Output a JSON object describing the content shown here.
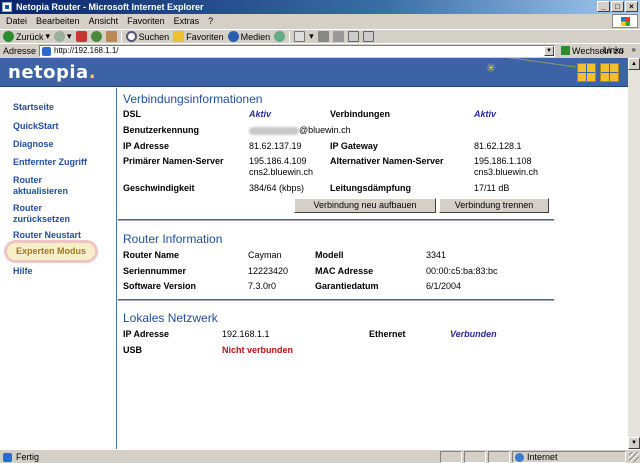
{
  "window": {
    "title": "Netopia Router - Microsoft Internet Explorer",
    "buttons": [
      "_",
      "□",
      "×"
    ]
  },
  "menu": [
    "Datei",
    "Bearbeiten",
    "Ansicht",
    "Favoriten",
    "Extras",
    "?"
  ],
  "toolbar": {
    "back": "Zurück",
    "search": "Suchen",
    "favorites": "Favoriten",
    "media": "Medien"
  },
  "address": {
    "label": "Adresse",
    "url": "http://192.168.1.1/",
    "go": "Wechseln zu",
    "links": "Links",
    "links_arrow": "»"
  },
  "banner": {
    "logo": "netopia",
    "logo_dot": "."
  },
  "nav": [
    "Startseite",
    "QuickStart",
    "Diagnose",
    "Entfernter Zugriff",
    "Router aktualisieren",
    "Router zurücksetzen",
    "Router Neustart",
    "Experten Modus",
    "Hilfe"
  ],
  "connection": {
    "title": "Verbindungsinformationen",
    "dsl_label": "DSL",
    "dsl_value": "Aktiv",
    "connections_label": "Verbindungen",
    "connections_value": "Aktiv",
    "user_label": "Benutzerkennung",
    "user_value": "@bluewin.ch",
    "ip_label": "IP Adresse",
    "ip_value": "81.62.137.19",
    "gateway_label": "IP Gateway",
    "gateway_value": "81.62.128.1",
    "primary_dns_label": "Primärer Namen-Server",
    "primary_dns_ip": "195.186.4.109",
    "primary_dns_host": "cns2.bluewin.ch",
    "alt_dns_label": "Alternativer Namen-Server",
    "alt_dns_ip": "195.186.1.108",
    "alt_dns_host": "cns3.bluewin.ch",
    "speed_label": "Geschwindigkeit",
    "speed_value": "384/64 (kbps)",
    "attenuation_label": "Leitungsdämpfung",
    "attenuation_value": "17/11 dB",
    "reconnect_button": "Verbindung neu aufbauen",
    "disconnect_button": "Verbindung trennen"
  },
  "router": {
    "title": "Router Information",
    "name_label": "Router Name",
    "name_value": "Cayman",
    "model_label": "Modell",
    "model_value": "3341",
    "serial_label": "Seriennummer",
    "serial_value": "12223420",
    "mac_label": "MAC Adresse",
    "mac_value": "00:00:c5:ba:83:bc",
    "software_label": "Software Version",
    "software_value": "7.3.0r0",
    "warranty_label": "Garantiedatum",
    "warranty_value": "6/1/2004"
  },
  "lan": {
    "title": "Lokales Netzwerk",
    "ip_label": "IP Adresse",
    "ip_value": "192.168.1.1",
    "ethernet_label": "Ethernet",
    "ethernet_value": "Verbunden",
    "usb_label": "USB",
    "usb_value": "Nicht verbunden"
  },
  "status": {
    "text": "Fertig",
    "zone": "Internet"
  }
}
